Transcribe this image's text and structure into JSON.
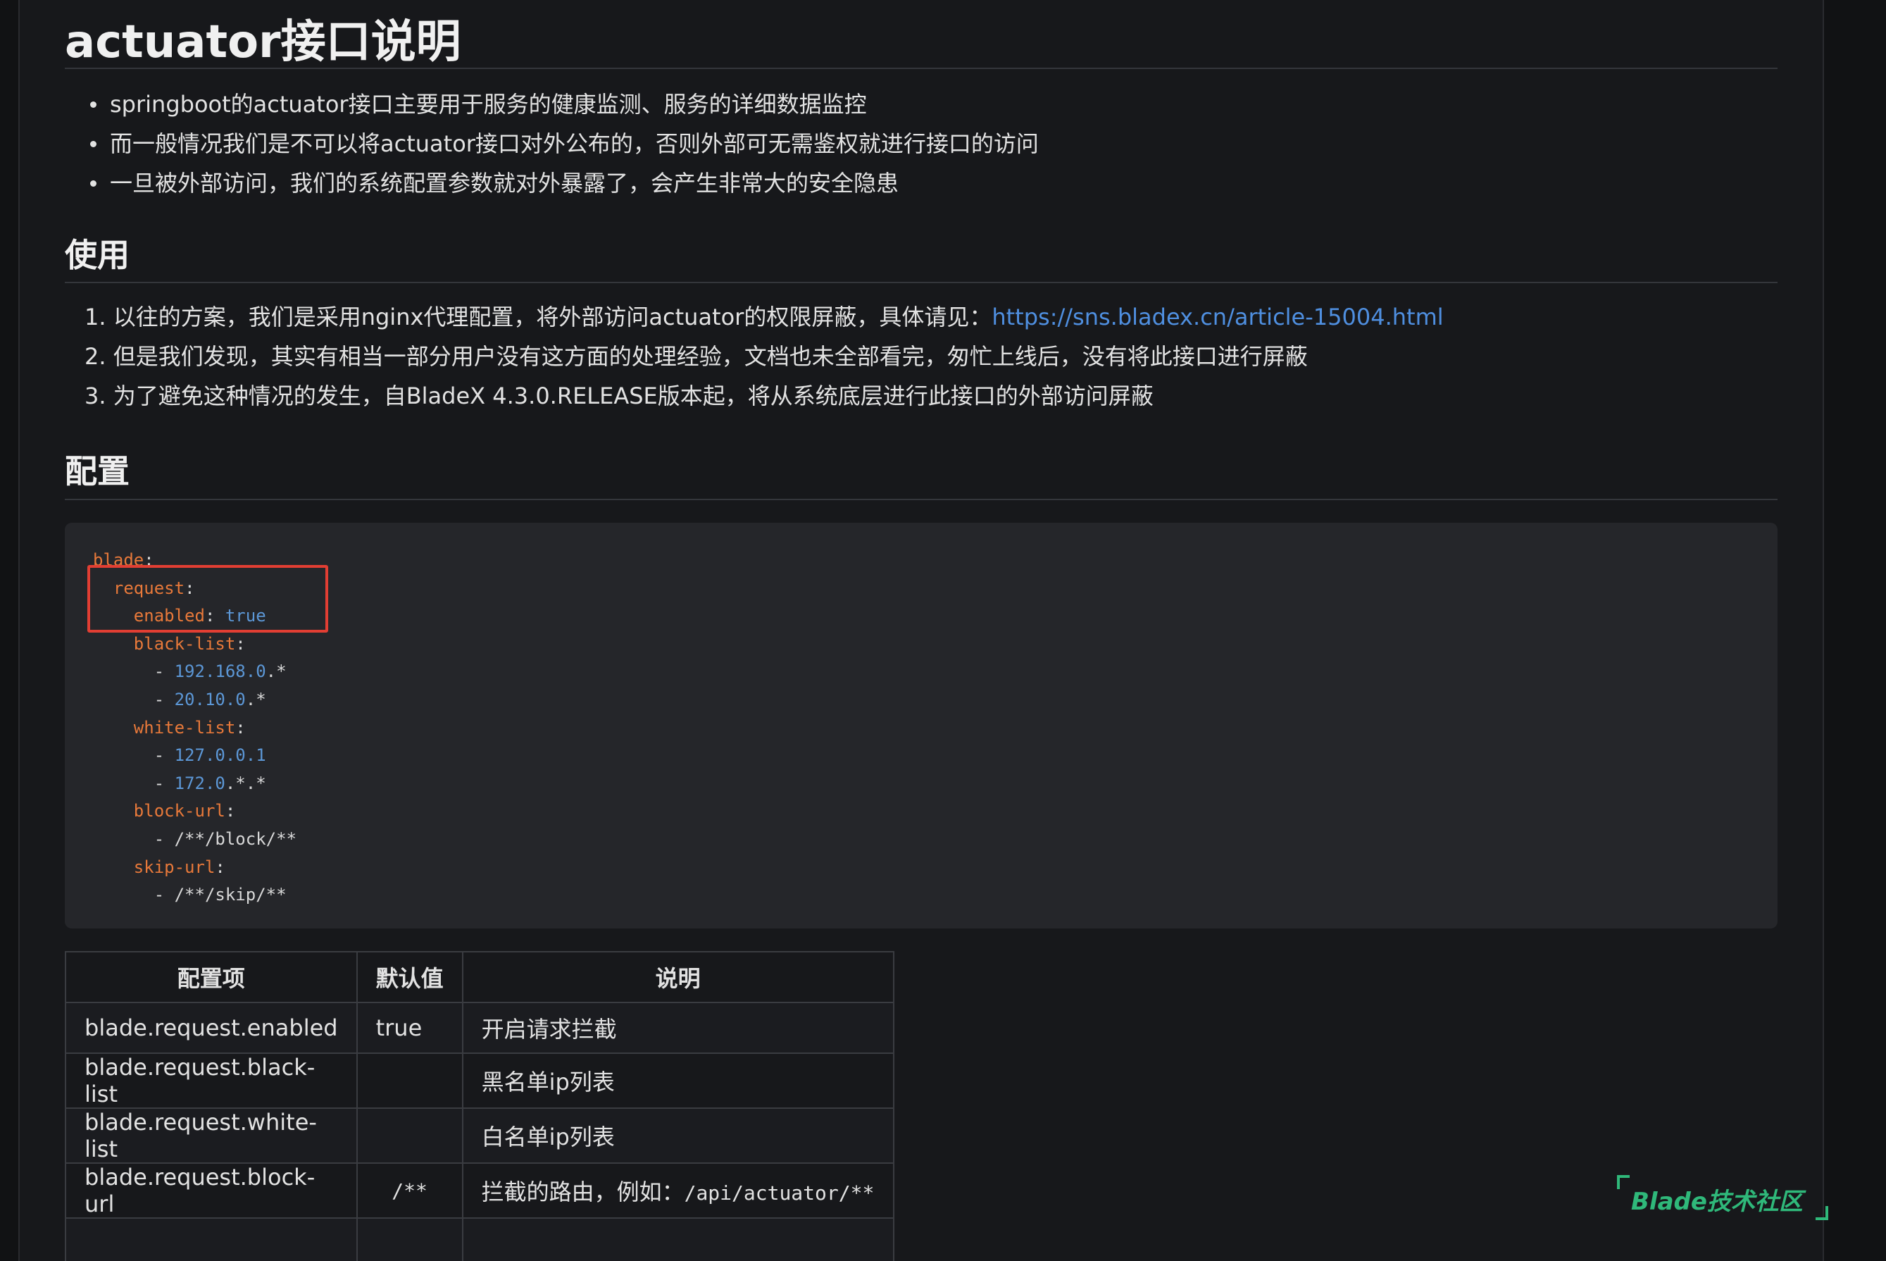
{
  "title": "actuator接口说明",
  "intro": [
    "springboot的actuator接口主要用于服务的健康监测、服务的详细数据监控",
    "而一般情况我们是不可以将actuator接口对外公布的，否则外部可无需鉴权就进行接口的访问",
    "一旦被外部访问，我们的系统配置参数就对外暴露了，会产生非常大的安全隐患"
  ],
  "usage": {
    "heading": "使用",
    "items": [
      {
        "num": "1.",
        "text": "以往的方案，我们是采用nginx代理配置，将外部访问actuator的权限屏蔽，具体请见：",
        "link": "https://sns.bladex.cn/article-15004.html"
      },
      {
        "num": "2.",
        "text": "但是我们发现，其实有相当一部分用户没有这方面的处理经验，文档也未全部看完，匆忙上线后，没有将此接口进行屏蔽"
      },
      {
        "num": "3.",
        "text": "为了避免这种情况的发生，自BladeX 4.3.0.RELEASE版本起，将从系统底层进行此接口的外部访问屏蔽"
      }
    ]
  },
  "config": {
    "heading": "配置",
    "code": [
      {
        "key": "blade",
        "sep": ":",
        "val": ""
      },
      {
        "key": "request",
        "sep": ":",
        "val": "",
        "indent": "  "
      },
      {
        "key": "enabled",
        "sep": ": ",
        "val": "true",
        "indent": "    "
      },
      {
        "key": "black-list",
        "sep": ":",
        "val": "",
        "indent": "    "
      },
      {
        "item_num": "192.168.0",
        "item_rest": ".*",
        "indent": "      - "
      },
      {
        "item_num": "20.10.0",
        "item_rest": ".*",
        "indent": "      - "
      },
      {
        "key": "white-list",
        "sep": ":",
        "val": "",
        "indent": "    "
      },
      {
        "item_num": "127.0.0.1",
        "item_rest": "",
        "indent": "      - "
      },
      {
        "item_num": "172.0",
        "item_rest": ".*.*",
        "indent": "      - "
      },
      {
        "key": "block-url",
        "sep": ":",
        "val": "",
        "indent": "    "
      },
      {
        "item_num": "",
        "item_rest": "/**/block/**",
        "indent": "      - "
      },
      {
        "key": "skip-url",
        "sep": ":",
        "val": "",
        "indent": "    "
      },
      {
        "item_num": "",
        "item_rest": "/**/skip/**",
        "indent": "      - "
      }
    ],
    "highlight_color": "#e23e33"
  },
  "table": {
    "headers": [
      "配置项",
      "默认值",
      "说明"
    ],
    "rows": [
      {
        "item": "blade.request.enabled",
        "default": "true",
        "desc": "开启请求拦截",
        "default_mono": false
      },
      {
        "item": "blade.request.black-list",
        "default": "",
        "desc": "黑名单ip列表",
        "default_mono": false
      },
      {
        "item": "blade.request.white-list",
        "default": "",
        "desc": "白名单ip列表",
        "default_mono": false
      },
      {
        "item": "blade.request.block-url",
        "default": "/**",
        "desc": "拦截的路由，例如：",
        "desc_code": "/api/actuator/**",
        "default_mono": true
      }
    ]
  },
  "watermark": "Blade技术社区",
  "colors": {
    "background": "#17181b",
    "code_bg": "#25262a",
    "key": "#e8793a",
    "number": "#5c97d6",
    "link": "#4f8fe0",
    "watermark": "#2fb87a"
  }
}
